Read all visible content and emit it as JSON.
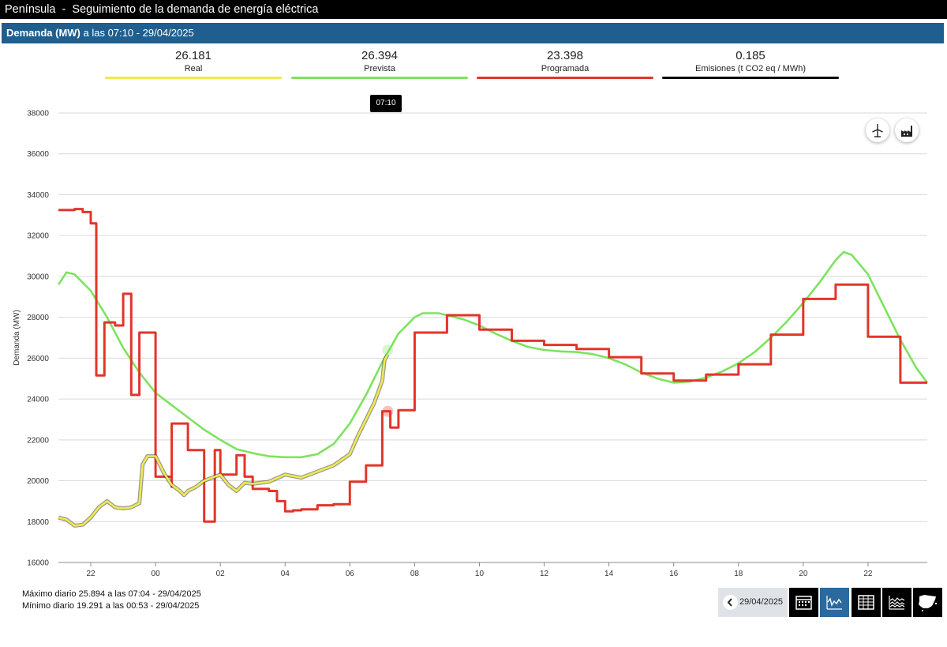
{
  "header": {
    "title": "Península  -  Seguimiento de la demanda de energía eléctrica"
  },
  "subheader": {
    "label": "Demanda (MW)",
    "time_text": " a las 07:10 - 29/04/2025"
  },
  "legend": [
    {
      "value": "26.181",
      "name": "Real",
      "color": "#f0ea4b"
    },
    {
      "value": "26.394",
      "name": "Prevista",
      "color": "#7de35e"
    },
    {
      "value": "23.398",
      "name": "Programada",
      "color": "#e2352a"
    },
    {
      "value": "0.185",
      "name": "Emisiones (t CO2 eq / MWh)",
      "color": "#000000"
    }
  ],
  "tooltip": "07:10",
  "stats": {
    "max": "Máximo diario 25.894 a las 07:04 - 29/04/2025",
    "min": "Mínimo diario 19.291 a las 00:53 - 29/04/2025"
  },
  "nav": {
    "date": "29/04/2025"
  },
  "icons": [
    "wind-turbine-icon",
    "factory-icon",
    "chevron-left-icon",
    "calendar-icon",
    "line-chart-icon",
    "table-icon",
    "area-chart-icon",
    "spain-map-icon"
  ],
  "chart_data": {
    "type": "line",
    "xlabel": "",
    "ylabel": "Demanda (MW)",
    "ylim": [
      16000,
      38000
    ],
    "yticks": [
      16000,
      18000,
      20000,
      22000,
      24000,
      26000,
      28000,
      30000,
      32000,
      34000,
      36000,
      38000
    ],
    "xlim": [
      -3.0,
      23.83
    ],
    "xticks": [
      {
        "x": -2,
        "label": "22"
      },
      {
        "x": 0,
        "label": "00"
      },
      {
        "x": 2,
        "label": "02"
      },
      {
        "x": 4,
        "label": "04"
      },
      {
        "x": 6,
        "label": "06"
      },
      {
        "x": 8,
        "label": "08"
      },
      {
        "x": 10,
        "label": "10"
      },
      {
        "x": 12,
        "label": "12"
      },
      {
        "x": 14,
        "label": "14"
      },
      {
        "x": 16,
        "label": "16"
      },
      {
        "x": 18,
        "label": "18"
      },
      {
        "x": 20,
        "label": "20"
      },
      {
        "x": 22,
        "label": "22"
      }
    ],
    "grid": true,
    "series": [
      {
        "name": "Prevista",
        "color": "#7de35e",
        "step": false,
        "points": [
          [
            -3.0,
            29600
          ],
          [
            -2.75,
            30200
          ],
          [
            -2.5,
            30100
          ],
          [
            -2.0,
            29300
          ],
          [
            -1.5,
            28000
          ],
          [
            -1.0,
            26500
          ],
          [
            -0.5,
            25300
          ],
          [
            0.0,
            24300
          ],
          [
            0.5,
            23700
          ],
          [
            1.0,
            23100
          ],
          [
            1.5,
            22500
          ],
          [
            2.0,
            22000
          ],
          [
            2.5,
            21550
          ],
          [
            3.0,
            21350
          ],
          [
            3.5,
            21200
          ],
          [
            4.0,
            21150
          ],
          [
            4.5,
            21150
          ],
          [
            5.0,
            21300
          ],
          [
            5.5,
            21800
          ],
          [
            6.0,
            22800
          ],
          [
            6.5,
            24200
          ],
          [
            7.0,
            25800
          ],
          [
            7.5,
            27200
          ],
          [
            8.0,
            28000
          ],
          [
            8.25,
            28200
          ],
          [
            8.75,
            28200
          ],
          [
            9.5,
            27900
          ],
          [
            10.0,
            27600
          ],
          [
            10.5,
            27200
          ],
          [
            11.0,
            26850
          ],
          [
            11.5,
            26550
          ],
          [
            12.0,
            26400
          ],
          [
            12.5,
            26330
          ],
          [
            13.0,
            26300
          ],
          [
            13.5,
            26200
          ],
          [
            14.0,
            26000
          ],
          [
            14.5,
            25700
          ],
          [
            15.0,
            25300
          ],
          [
            15.5,
            25000
          ],
          [
            16.0,
            24800
          ],
          [
            16.5,
            24850
          ],
          [
            17.0,
            25050
          ],
          [
            17.5,
            25350
          ],
          [
            18.0,
            25750
          ],
          [
            18.5,
            26300
          ],
          [
            19.0,
            27000
          ],
          [
            19.5,
            27800
          ],
          [
            20.0,
            28700
          ],
          [
            20.5,
            29700
          ],
          [
            21.0,
            30800
          ],
          [
            21.25,
            31200
          ],
          [
            21.5,
            31050
          ],
          [
            22.0,
            30100
          ],
          [
            22.5,
            28500
          ],
          [
            23.0,
            26900
          ],
          [
            23.5,
            25500
          ],
          [
            23.83,
            24800
          ]
        ]
      },
      {
        "name": "Real",
        "color": "#f0ea4b",
        "step": false,
        "points": [
          [
            -3.0,
            18200
          ],
          [
            -2.75,
            18100
          ],
          [
            -2.5,
            17800
          ],
          [
            -2.25,
            17850
          ],
          [
            -2.0,
            18200
          ],
          [
            -1.75,
            18700
          ],
          [
            -1.5,
            19000
          ],
          [
            -1.25,
            18700
          ],
          [
            -1.0,
            18650
          ],
          [
            -0.75,
            18700
          ],
          [
            -0.5,
            18900
          ],
          [
            -0.4,
            20800
          ],
          [
            -0.25,
            21200
          ],
          [
            0.0,
            21200
          ],
          [
            0.25,
            20400
          ],
          [
            0.5,
            19800
          ],
          [
            0.75,
            19500
          ],
          [
            0.88,
            19291
          ],
          [
            1.0,
            19500
          ],
          [
            1.25,
            19700
          ],
          [
            1.5,
            20000
          ],
          [
            1.75,
            20150
          ],
          [
            2.0,
            20300
          ],
          [
            2.25,
            19800
          ],
          [
            2.5,
            19500
          ],
          [
            2.75,
            19900
          ],
          [
            3.0,
            19850
          ],
          [
            3.5,
            19950
          ],
          [
            4.0,
            20300
          ],
          [
            4.5,
            20150
          ],
          [
            5.0,
            20450
          ],
          [
            5.5,
            20750
          ],
          [
            6.0,
            21300
          ],
          [
            6.25,
            22200
          ],
          [
            6.5,
            23000
          ],
          [
            6.75,
            23800
          ],
          [
            7.0,
            24900
          ],
          [
            7.07,
            25894
          ],
          [
            7.17,
            26181
          ]
        ]
      },
      {
        "name": "Programada",
        "color": "#e2352a",
        "step": true,
        "points": [
          [
            -3.0,
            33250
          ],
          [
            -2.5,
            33300
          ],
          [
            -2.25,
            33150
          ],
          [
            -2.0,
            32600
          ],
          [
            -1.83,
            25150
          ],
          [
            -1.58,
            27750
          ],
          [
            -1.25,
            27600
          ],
          [
            -1.0,
            29150
          ],
          [
            -0.75,
            24200
          ],
          [
            -0.5,
            27250
          ],
          [
            0.0,
            20200
          ],
          [
            0.5,
            19700
          ],
          [
            0.5,
            22800
          ],
          [
            1.0,
            21500
          ],
          [
            1.5,
            18000
          ],
          [
            1.83,
            21500
          ],
          [
            2.0,
            20300
          ],
          [
            2.5,
            21250
          ],
          [
            2.75,
            20200
          ],
          [
            3.0,
            19600
          ],
          [
            3.5,
            19500
          ],
          [
            3.75,
            19000
          ],
          [
            4.0,
            18500
          ],
          [
            4.25,
            18550
          ],
          [
            4.5,
            18600
          ],
          [
            5.0,
            18800
          ],
          [
            5.5,
            18850
          ],
          [
            6.0,
            19950
          ],
          [
            6.5,
            20750
          ],
          [
            7.0,
            23400
          ],
          [
            7.25,
            22600
          ],
          [
            7.5,
            23450
          ],
          [
            8.0,
            27250
          ],
          [
            9.0,
            28100
          ],
          [
            10.0,
            27400
          ],
          [
            11.0,
            26850
          ],
          [
            12.0,
            26650
          ],
          [
            13.0,
            26450
          ],
          [
            14.0,
            26050
          ],
          [
            15.0,
            25250
          ],
          [
            16.0,
            24900
          ],
          [
            17.0,
            25200
          ],
          [
            18.0,
            25700
          ],
          [
            19.0,
            27150
          ],
          [
            20.0,
            28900
          ],
          [
            21.0,
            29600
          ],
          [
            22.0,
            27050
          ],
          [
            23.0,
            24800
          ],
          [
            23.83,
            24800
          ]
        ]
      }
    ],
    "markers": [
      {
        "series": "Prevista",
        "x": 7.17,
        "y": 26394,
        "color": "#7de35e"
      },
      {
        "series": "Programada",
        "x": 7.17,
        "y": 23398,
        "color": "#e2352a"
      }
    ]
  }
}
